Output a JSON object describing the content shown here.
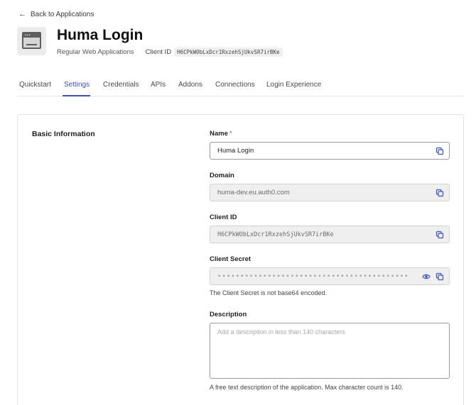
{
  "back": {
    "arrow": "←",
    "label": "Back to Applications"
  },
  "app": {
    "icon": "application-window-icon",
    "title": "Huma Login",
    "type": "Regular Web Applications",
    "client_id_label": "Client ID",
    "client_id": "H6CPkWObLxDcr1RxzehSjUkvSR7irBKe"
  },
  "tabs": [
    {
      "label": "Quickstart"
    },
    {
      "label": "Settings",
      "active": true
    },
    {
      "label": "Credentials"
    },
    {
      "label": "APIs"
    },
    {
      "label": "Addons"
    },
    {
      "label": "Connections"
    },
    {
      "label": "Login Experience"
    }
  ],
  "basic_info": {
    "title": "Basic Information",
    "name": {
      "label": "Name",
      "required_mark": "*",
      "value": "Huma Login"
    },
    "domain": {
      "label": "Domain",
      "value": "huma-dev.eu.auth0.com"
    },
    "client_id": {
      "label": "Client ID",
      "value": "H6CPkWObLxDcr1RxzehSjUkvSR7irBKe"
    },
    "client_secret": {
      "label": "Client Secret",
      "masked": "••••••••••••••••••••••••••••••••••••••••••••••••••••••••••••••",
      "note": "The Client Secret is not base64 encoded."
    },
    "description": {
      "label": "Description",
      "placeholder": "Add a description in less than 140 characters",
      "help": "A free text description of the application. Max character count is 140."
    }
  },
  "colors": {
    "accent": "#3e51c4",
    "readonly_bg": "#efefef",
    "border": "#e4e4e4"
  },
  "icons": {
    "copy": "copy-icon",
    "reveal": "eye-icon"
  }
}
